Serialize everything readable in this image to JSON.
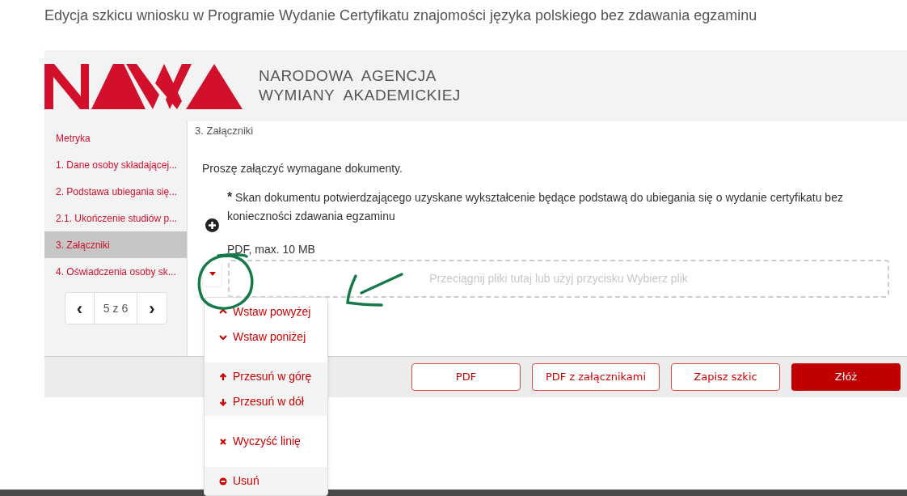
{
  "page_title": "Edycja szkicu wniosku w Programie Wydanie Certyfikatu znajomości języka polskiego bez zdawania egzaminu",
  "header": {
    "org_name_lines": [
      "NARODOWA  AGENCJA",
      "WYMIANY  AKADEMICKIEJ"
    ]
  },
  "sidebar": {
    "items": [
      {
        "label": "Metryka",
        "selected": false
      },
      {
        "label": "1. Dane osoby składającej...",
        "selected": false
      },
      {
        "label": "2. Podstawa ubiegania się...",
        "selected": false
      },
      {
        "label": "2.1. Ukończenie studiów p...",
        "selected": false
      },
      {
        "label": "3. Załączniki",
        "selected": true
      },
      {
        "label": "4. Oświadczenia osoby sk...",
        "selected": false
      }
    ],
    "pager": {
      "prev": "‹",
      "page": "5 z 6",
      "next": "›"
    }
  },
  "section_title": "3. Załączniki",
  "intro": "Proszę załączyć wymagane dokumenty.",
  "attachment": {
    "required_mark": "*",
    "label": "Skan dokumentu potwierdzającego uzyskane wykształcenie będące podstawą do ubiegania się o wydanie certyfikatu bez konieczności zdawania egzaminu",
    "hint": "PDF, max. 10 MB",
    "drop_zone": "Przeciągnij pliki tutaj lub użyj przycisku Wybierz plik"
  },
  "row_menu": {
    "groups": [
      {
        "items": [
          "Wstaw powyżej",
          "Wstaw poniżej"
        ]
      },
      {
        "items": [
          "Przesuń w górę",
          "Przesuń w dół"
        ]
      },
      {
        "items": [
          "Wyczyść linię"
        ]
      },
      {
        "items": [
          "Usuń"
        ]
      }
    ]
  },
  "footer_buttons": [
    {
      "label": "PDF",
      "primary": false
    },
    {
      "label": "PDF z załącznikami",
      "primary": false
    },
    {
      "label": "Zapisz szkic",
      "primary": false
    },
    {
      "label": "Złóż",
      "primary": true
    }
  ]
}
